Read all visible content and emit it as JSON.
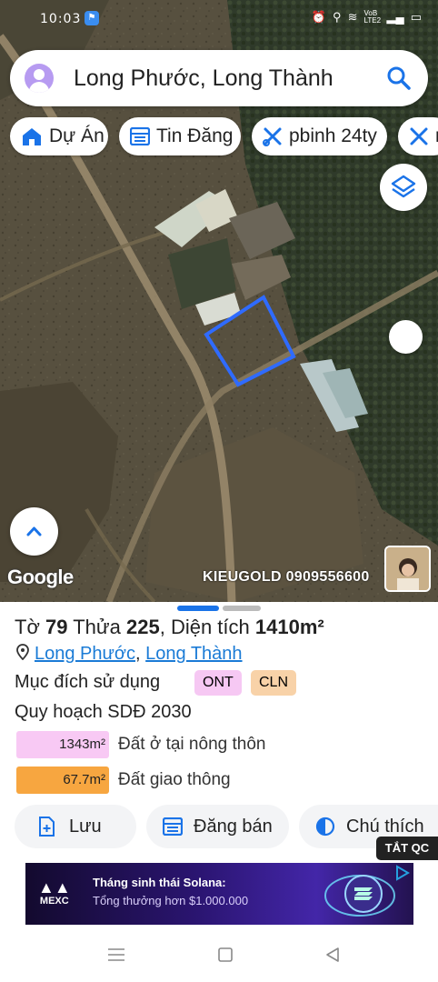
{
  "status_bar": {
    "time": "10:03",
    "network": "VoB LTE2"
  },
  "search": {
    "query": "Long Phước, Long Thành"
  },
  "chips": [
    {
      "label": "Dự Án",
      "icon": "home-icon"
    },
    {
      "label": "Tin Đăng",
      "icon": "list-icon"
    },
    {
      "label": "pbinh 24ty",
      "icon": "tools-icon"
    },
    {
      "label": "n",
      "icon": "tools-icon"
    }
  ],
  "map": {
    "google_label": "Google",
    "watermark": "KIEUGOLD 0909556600",
    "parcel_color": "#2f6bff"
  },
  "parcel": {
    "to_label": "Tờ",
    "to_value": "79",
    "thua_label": "Thửa",
    "thua_value": "225",
    "dientich_label": "Diện tích",
    "area_value": "1410m²",
    "ward": "Long Phước",
    "district": "Long Thành",
    "purpose_label": "Mục đích sử dụng",
    "tags": [
      {
        "label": "ONT",
        "color": "#f6c8f3"
      },
      {
        "label": "CLN",
        "color": "#f8d2a8"
      }
    ],
    "plan_label": "Quy hoạch SDĐ 2030",
    "areas": [
      {
        "value": "1343m²",
        "label": "Đất ở tại nông thôn",
        "color": "#f8c9f4"
      },
      {
        "value": "67.7m²",
        "label": "Đất giao thông",
        "color": "#f7a640"
      }
    ]
  },
  "actions": {
    "save": "Lưu",
    "post": "Đăng bán",
    "legend": "Chú thích",
    "hide_ads": "TẮT QC"
  },
  "ad": {
    "brand": "MEXC",
    "headline": "Tháng sinh thái Solana:",
    "subline": "Tổng thưởng hơn $1.000.000"
  }
}
